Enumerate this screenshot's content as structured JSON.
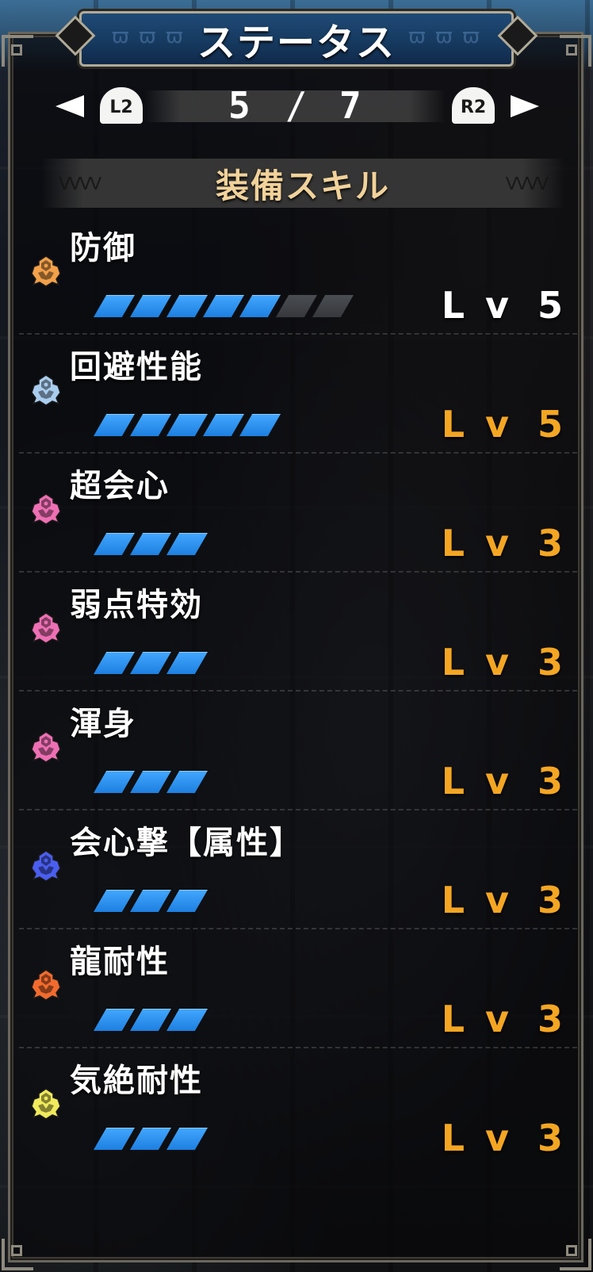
{
  "title": "ステータス",
  "pager": {
    "prev_button": "L2",
    "next_button": "R2",
    "current": "5",
    "separator": "/",
    "total": "7"
  },
  "section_title": "装備スキル",
  "colors": {
    "level_max": "#ffffff",
    "level_normal": "#f4a623",
    "pip_on": "#2f96f5",
    "pip_off": "#45484c",
    "title_banner": "#1b4169",
    "section_title_text": "#f1d29a"
  },
  "skills": [
    {
      "name": "防御",
      "icon": "skill-gem-icon",
      "icon_color": "#f2a04a",
      "level": 5,
      "max_level": 7,
      "level_label": "Lv",
      "level_value": "5",
      "level_color": "#ffffff"
    },
    {
      "name": "回避性能",
      "icon": "skill-gem-icon",
      "icon_color": "#a9cdef",
      "level": 5,
      "max_level": 5,
      "level_label": "Lv",
      "level_value": "5",
      "level_color": "#f4a623"
    },
    {
      "name": "超会心",
      "icon": "skill-gem-icon",
      "icon_color": "#ee6fb4",
      "level": 3,
      "max_level": 3,
      "level_label": "Lv",
      "level_value": "3",
      "level_color": "#f4a623"
    },
    {
      "name": "弱点特効",
      "icon": "skill-gem-icon",
      "icon_color": "#ee6fb4",
      "level": 3,
      "max_level": 3,
      "level_label": "Lv",
      "level_value": "3",
      "level_color": "#f4a623"
    },
    {
      "name": "渾身",
      "icon": "skill-gem-icon",
      "icon_color": "#ee6fb4",
      "level": 3,
      "max_level": 3,
      "level_label": "Lv",
      "level_value": "3",
      "level_color": "#f4a623"
    },
    {
      "name": "会心撃【属性】",
      "icon": "skill-gem-icon",
      "icon_color": "#4a5ef0",
      "level": 3,
      "max_level": 3,
      "level_label": "Lv",
      "level_value": "3",
      "level_color": "#f4a623"
    },
    {
      "name": "龍耐性",
      "icon": "skill-gem-icon",
      "icon_color": "#f26b2e",
      "level": 3,
      "max_level": 3,
      "level_label": "Lv",
      "level_value": "3",
      "level_color": "#f4a623"
    },
    {
      "name": "気絶耐性",
      "icon": "skill-gem-icon",
      "icon_color": "#f0ea5c",
      "level": 3,
      "max_level": 3,
      "level_label": "Lv",
      "level_value": "3",
      "level_color": "#f4a623"
    }
  ]
}
